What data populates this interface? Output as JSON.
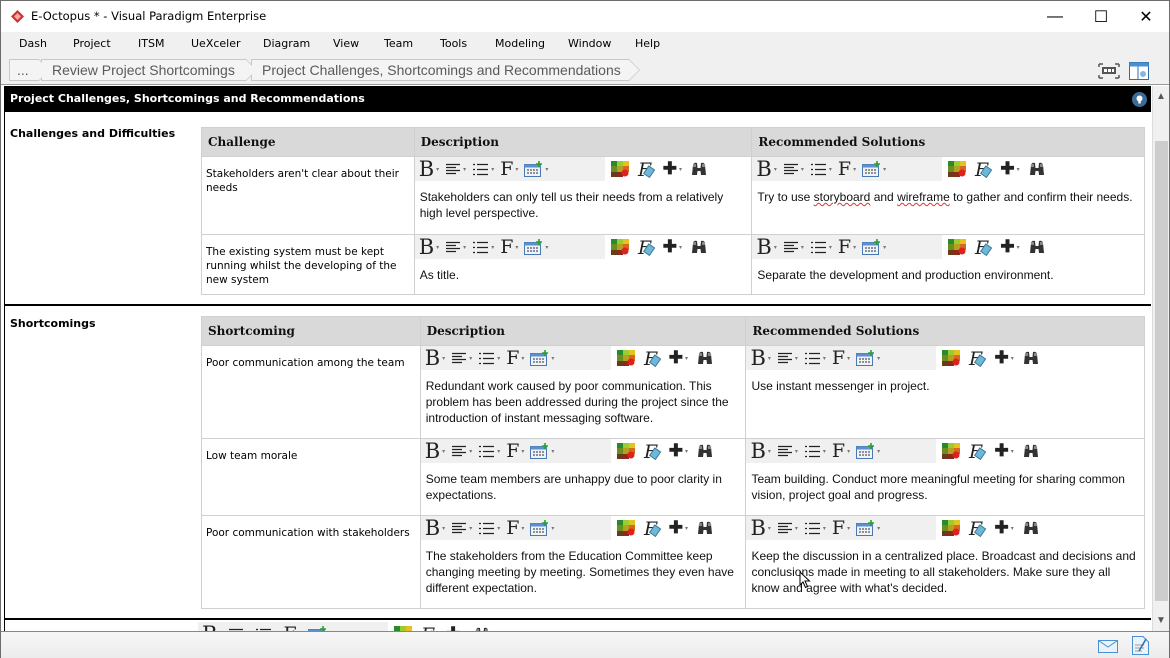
{
  "window": {
    "title": "E-Octopus * - Visual Paradigm Enterprise",
    "controls": {
      "minimize": "—",
      "maximize": "☐",
      "close": "✕"
    }
  },
  "menu": [
    "Dash",
    "Project",
    "ITSM",
    "UeXceler",
    "Diagram",
    "View",
    "Team",
    "Tools",
    "Modeling",
    "Window",
    "Help"
  ],
  "breadcrumb": {
    "overflow": "...",
    "items": [
      "Review Project Shortcomings",
      "Project Challenges, Shortcomings and Recommendations"
    ]
  },
  "page": {
    "title": "Project Challenges, Shortcomings and Recommendations"
  },
  "challenges": {
    "label": "Challenges and Difficulties",
    "columns": [
      "Challenge",
      "Description",
      "Recommended Solutions"
    ],
    "rows": [
      {
        "challenge": "Stakeholders aren't clear about their needs",
        "description": "Stakeholders can only tell us their needs from a relatively high level perspective.",
        "solution_pre": "Try to use ",
        "solution_w1": "storyboard",
        "solution_mid": " and ",
        "solution_w2": "wireframe",
        "solution_post": " to gather and confirm their needs."
      },
      {
        "challenge": "The existing system must be kept running whilst the developing of the new system",
        "description": "As title.",
        "solution": "Separate the development and production environment."
      }
    ]
  },
  "shortcomings": {
    "label": "Shortcomings",
    "columns": [
      "Shortcoming",
      "Description",
      "Recommended Solutions"
    ],
    "rows": [
      {
        "shortcoming": "Poor communication among the team",
        "description": "Redundant work caused by poor communication. This problem has been addressed during the project since the introduction of instant messaging software.",
        "solution": "Use instant messenger in project."
      },
      {
        "shortcoming": "Low team morale",
        "description": "Some team members are unhappy due to poor clarity in expectations.",
        "solution": "Team building. Conduct more meaningful meeting for sharing common vision, project goal and progress."
      },
      {
        "shortcoming": "Poor communication with stakeholders",
        "description": "The stakeholders from the Education Committee keep changing meeting by meeting. Sometimes they even have different expectation.",
        "solution": "Keep the discussion in a centralized place. Broadcast and decisions and conclusions made in meeting to all stakeholders. Make sure they all know and agree with what's decided."
      }
    ]
  },
  "toolbar": {
    "bold": "B",
    "font": "F",
    "arrow": "▾",
    "plus": "✚"
  },
  "colors": {
    "header_band": "#000000",
    "table_header": "#d9d9d9",
    "toolbar_bg": "#f0f0f0",
    "app_icon": "#d4302b"
  }
}
